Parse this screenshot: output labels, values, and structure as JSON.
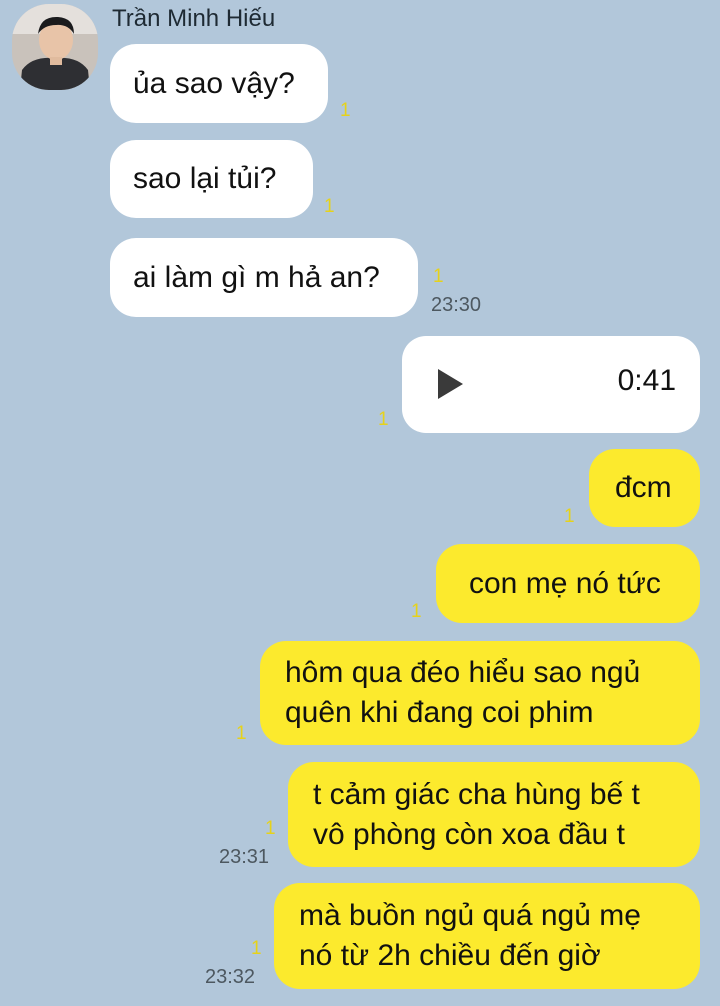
{
  "contact": {
    "name": "Trần Minh Hiếu",
    "avatar_icon": "user-photo"
  },
  "colors": {
    "background": "#b2c7da",
    "incoming": "#ffffff",
    "outgoing": "#fcea2d",
    "unread": "#e6d21a"
  },
  "messages": [
    {
      "text": "ủa sao vậy?",
      "unread": "1"
    },
    {
      "text": "sao lại tủi?",
      "unread": "1"
    },
    {
      "text": "ai làm gì m hả an?",
      "unread": "1",
      "time": "23:30"
    },
    {
      "type": "voice",
      "duration": "0:41",
      "unread": "1"
    },
    {
      "text": "đcm",
      "unread": "1"
    },
    {
      "text": "con mẹ nó tức",
      "unread": "1"
    },
    {
      "text": "hôm qua đéo hiểu sao ngủ\nquên khi đang coi phim",
      "unread": "1"
    },
    {
      "text": "t cảm giác cha hùng bế t\nvô phòng còn xoa đầu t",
      "unread": "1",
      "time": "23:31"
    },
    {
      "text": "mà buồn ngủ quá ngủ mẹ\nnó từ 2h chiều đến giờ",
      "unread": "1",
      "time": "23:32"
    }
  ]
}
